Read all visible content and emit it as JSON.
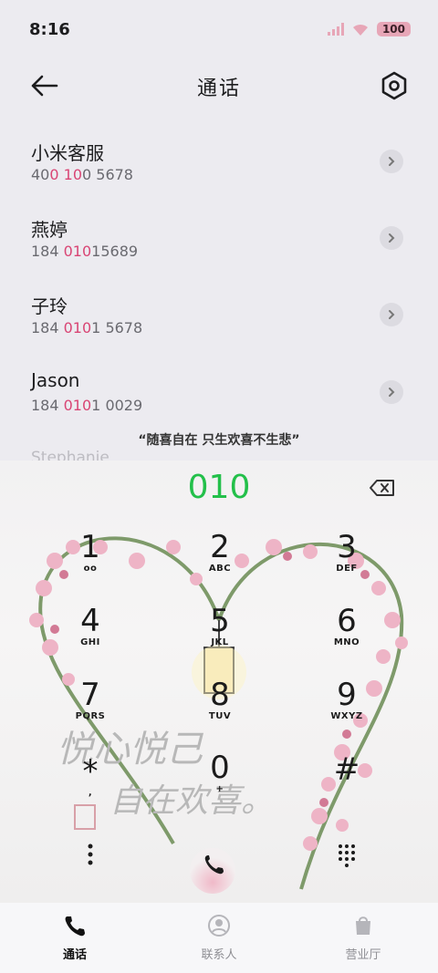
{
  "status_bar": {
    "time": "8:16",
    "battery": "100"
  },
  "header": {
    "title": "通话"
  },
  "contacts": [
    {
      "name": "小米客服",
      "num_pre": "40",
      "num_hl1": "0",
      "num_mid": " ",
      "num_hl2": "10",
      "num_post": "0 5678"
    },
    {
      "name": "燕婷",
      "num_pre": "184 ",
      "num_hl1": "010",
      "num_mid": "",
      "num_hl2": "",
      "num_post": "15689"
    },
    {
      "name": "子玲",
      "num_pre": "184 ",
      "num_hl1": "010",
      "num_mid": "",
      "num_hl2": "",
      "num_post": "1 5678"
    },
    {
      "name": "Jason",
      "num_pre": "184 ",
      "num_hl1": "010",
      "num_mid": "",
      "num_hl2": "",
      "num_post": "1 0029"
    }
  ],
  "partial_contact": "Stephanie",
  "quote": "“随喜自在 只生欢喜不生悲”",
  "dialer": {
    "dialed": "010",
    "keys": [
      {
        "digit": "1",
        "letters": "ᴏᴏ"
      },
      {
        "digit": "2",
        "letters": "ABC"
      },
      {
        "digit": "3",
        "letters": "DEF"
      },
      {
        "digit": "4",
        "letters": "GHI"
      },
      {
        "digit": "5",
        "letters": "JKL"
      },
      {
        "digit": "6",
        "letters": "MNO"
      },
      {
        "digit": "7",
        "letters": "PQRS"
      },
      {
        "digit": "8",
        "letters": "TUV"
      },
      {
        "digit": "9",
        "letters": "WXYZ"
      },
      {
        "digit": "*",
        "letters": ","
      },
      {
        "digit": "0",
        "letters": "+"
      },
      {
        "digit": "#",
        "letters": ""
      }
    ],
    "wallpaper_text": [
      "悦心悦己",
      "自在欢喜。"
    ]
  },
  "bottom_nav": [
    {
      "label": "通话",
      "active": true
    },
    {
      "label": "联系人",
      "active": false
    },
    {
      "label": "营业厅",
      "active": false
    }
  ],
  "colors": {
    "accent_green": "#23c04a",
    "highlight_pink": "#d94574"
  }
}
